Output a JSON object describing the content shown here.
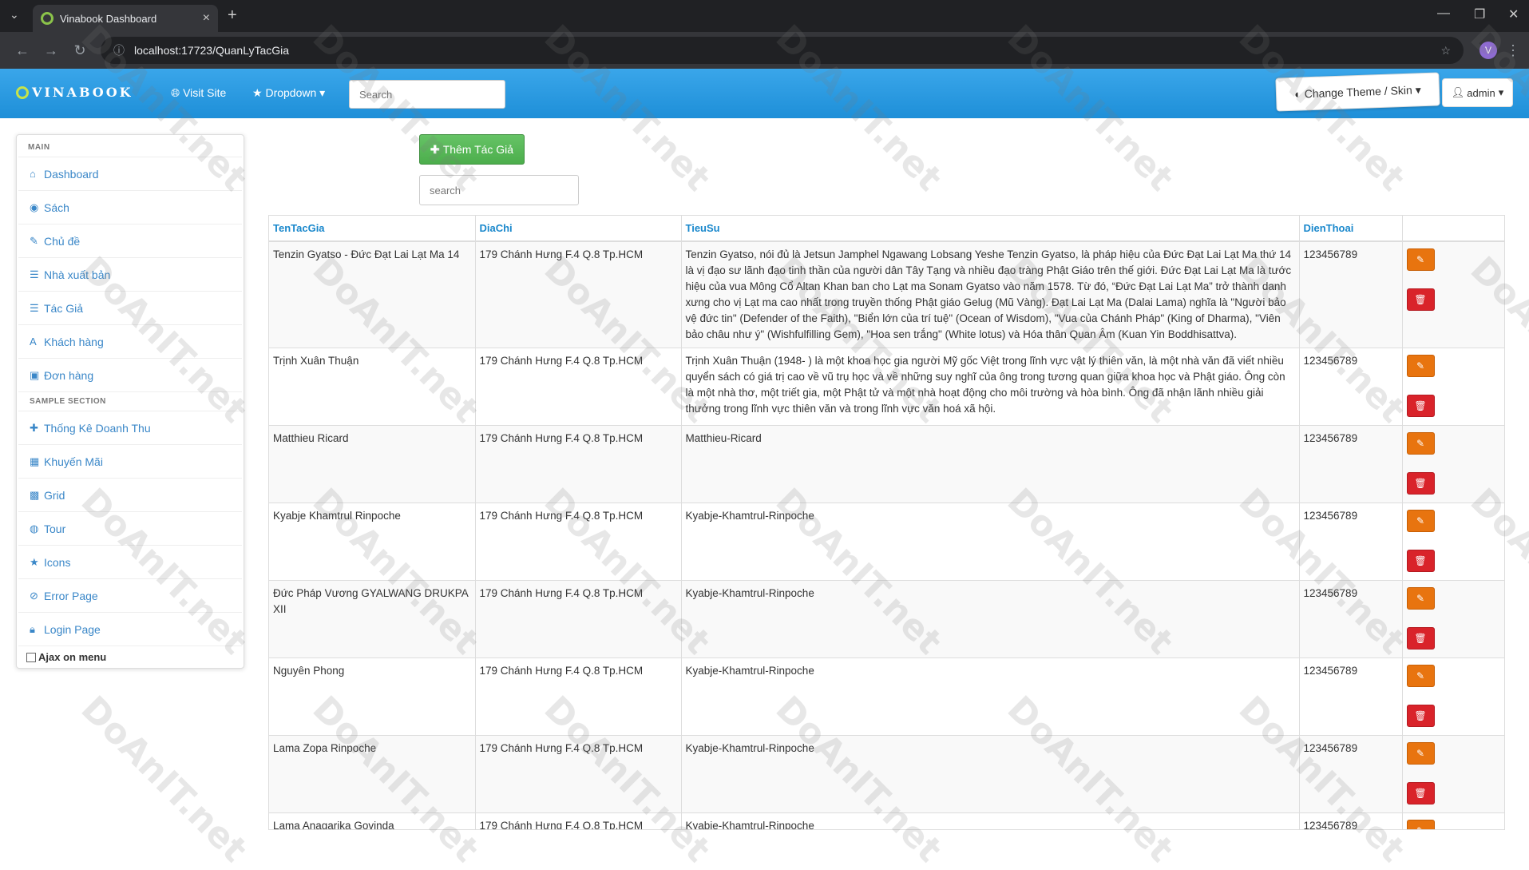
{
  "browser": {
    "tab_title": "Vinabook Dashboard",
    "url": "localhost:17723/QuanLyTacGia",
    "profile_initial": "V"
  },
  "navbar": {
    "brand": "VINABOOK",
    "visit_site": "Visit Site",
    "dropdown": "Dropdown",
    "search_placeholder": "Search",
    "change_theme": "Change Theme / Skin",
    "admin": "admin"
  },
  "sidebar": {
    "main_header": "MAIN",
    "main_items": [
      {
        "label": "Dashboard",
        "icon": "home-icon"
      },
      {
        "label": "Sách",
        "icon": "eye-icon"
      },
      {
        "label": "Chủ đề",
        "icon": "edit-icon"
      },
      {
        "label": "Nhà xuất bản",
        "icon": "list-icon"
      },
      {
        "label": "Tác Giả",
        "icon": "list-icon"
      },
      {
        "label": "Khách hàng",
        "icon": "font-icon"
      },
      {
        "label": "Đơn hàng",
        "icon": "picture-icon"
      }
    ],
    "sample_header": "SAMPLE SECTION",
    "sample_items": [
      {
        "label": "Thống Kê Doanh Thu",
        "icon": "plus-icon"
      },
      {
        "label": "Khuyến Mãi",
        "icon": "calendar-icon"
      },
      {
        "label": "Grid",
        "icon": "grid-icon"
      },
      {
        "label": "Tour",
        "icon": "globe-icon"
      },
      {
        "label": "Icons",
        "icon": "star-icon"
      },
      {
        "label": "Error Page",
        "icon": "ban-icon"
      },
      {
        "label": "Login Page",
        "icon": "lock-icon"
      }
    ],
    "ajax_label": "Ajax on menu"
  },
  "main": {
    "add_button": "Thêm Tác Giả",
    "search_placeholder": "search",
    "columns": [
      "TenTacGia",
      "DiaChi",
      "TieuSu",
      "DienThoai"
    ],
    "rows": [
      {
        "name": "Tenzin Gyatso - Đức Đạt Lai Lạt Ma 14",
        "address": "179 Chánh Hưng F.4 Q.8 Tp.HCM",
        "bio": "Tenzin Gyatso, nói đủ là Jetsun Jamphel Ngawang Lobsang Yeshe Tenzin Gyatso, là pháp hiệu của Đức Đạt Lai Lạt Ma thứ 14 là vị đạo sư lãnh đạo tinh thần của người dân Tây Tạng và nhiều đạo tràng Phật Giáo trên thế giới. Đức Đạt Lai Lạt Ma là tước hiệu của vua Mông Cổ Altan Khan ban cho Lạt ma Sonam Gyatso vào năm 1578. Từ đó, “Đức Đạt Lai Lạt Ma” trở thành danh xưng cho vị Lạt ma cao nhất trong truyền thống Phật giáo Gelug (Mũ Vàng). Đạt Lai Lạt Ma (Dalai Lama) nghĩa là \"Người bảo vệ đức tin\" (Defender of the Faith), \"Biển lớn của trí tuệ\" (Ocean of Wisdom), \"Vua của Chánh Pháp\" (King of Dharma), \"Viên bảo châu như ý\" (Wishfulfilling Gem), \"Hoa sen trắng\" (White lotus) và Hóa thân Quan Âm (Kuan Yin Boddhisattva).",
        "phone": "123456789"
      },
      {
        "name": "Trịnh Xuân Thuận",
        "address": "179 Chánh Hưng F.4 Q.8 Tp.HCM",
        "bio": "Trịnh Xuân Thuận (1948- ) là một khoa học gia người Mỹ gốc Việt trong lĩnh vực vật lý thiên văn, là một nhà văn đã viết nhiều quyển sách có giá trị cao về vũ trụ học và về những suy nghĩ của ông trong tương quan giữa khoa học và Phật giáo. Ông còn là một nhà thơ, một triết gia, một Phật tử và một nhà hoạt động cho môi trường và hòa bình. Ông đã nhận lãnh nhiều giải thưởng trong lĩnh vực thiên văn và trong lĩnh vực văn hoá xã hội.",
        "phone": "123456789"
      },
      {
        "name": "Matthieu Ricard",
        "address": "179 Chánh Hưng F.4 Q.8 Tp.HCM",
        "bio": "Matthieu-Ricard",
        "phone": "123456789"
      },
      {
        "name": "Kyabje Khamtrul Rinpoche",
        "address": "179 Chánh Hưng F.4 Q.8 Tp.HCM",
        "bio": "Kyabje-Khamtrul-Rinpoche",
        "phone": "123456789"
      },
      {
        "name": "Đức Pháp Vương GYALWANG DRUKPA XII",
        "address": "179 Chánh Hưng F.4 Q.8 Tp.HCM",
        "bio": "Kyabje-Khamtrul-Rinpoche",
        "phone": "123456789"
      },
      {
        "name": "Nguyên Phong",
        "address": "179 Chánh Hưng F.4 Q.8 Tp.HCM",
        "bio": "Kyabje-Khamtrul-Rinpoche",
        "phone": "123456789"
      },
      {
        "name": "Lama Zopa Rinpoche",
        "address": "179 Chánh Hưng F.4 Q.8 Tp.HCM",
        "bio": "Kyabje-Khamtrul-Rinpoche",
        "phone": "123456789"
      },
      {
        "name": "Lama Anagarika Govinda",
        "address": "179 Chánh Hưng F.4 Q.8 Tp.HCM",
        "bio": "Kyabje-Khamtrul-Rinpoche",
        "phone": "123456789"
      }
    ]
  },
  "watermark": "DoAnIT.net",
  "colors": {
    "navbar": "#1e8fd8",
    "link": "#3a87c8",
    "add_button": "#5cb85c",
    "edit_button": "#e8740f",
    "delete_button": "#d9232a"
  }
}
